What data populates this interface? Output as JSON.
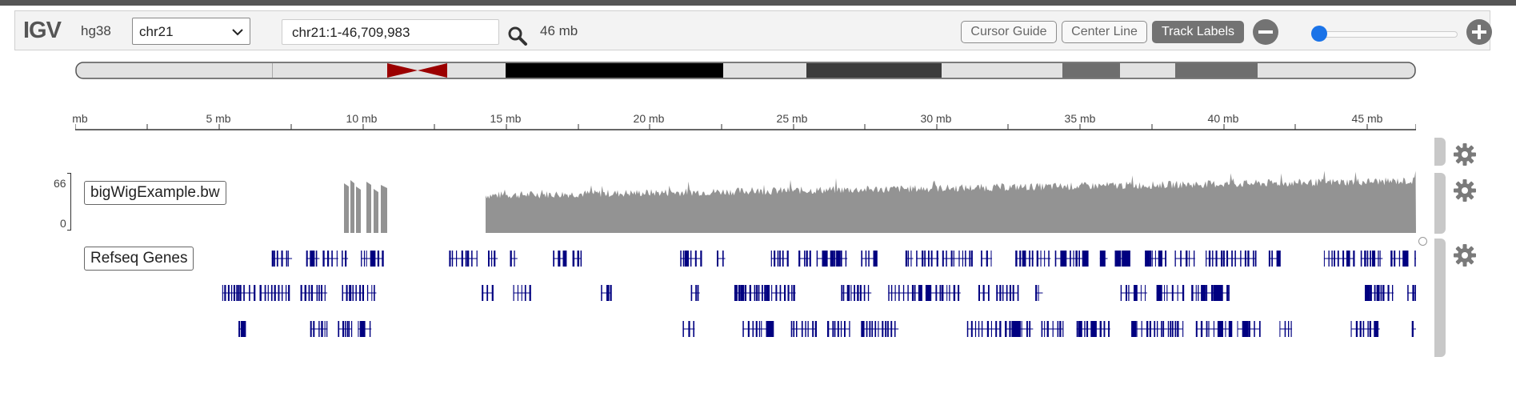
{
  "navbar": {
    "logo": "IGV",
    "genome": "hg38",
    "chromosome_select": "chr21",
    "locus": "chr21:1-46,709,983",
    "window_size": "46 mb",
    "buttons": {
      "cursor_guide": "Cursor Guide",
      "center_line": "Center Line",
      "track_labels": "Track Labels"
    },
    "zoom_fraction": 0.03
  },
  "ruler": {
    "labels": [
      "mb",
      "5 mb",
      "10 mb",
      "15 mb",
      "20 mb",
      "25 mb",
      "30 mb",
      "35 mb",
      "40 mb",
      "45 mb"
    ]
  },
  "tracks": {
    "wig": {
      "label": "bigWigExample.bw",
      "scale_max": "66",
      "scale_min": "0",
      "color": "#939393"
    },
    "refseq": {
      "label": "Refseq Genes",
      "color": "#000080"
    }
  },
  "colors": {
    "centromere": "#9b0000",
    "track_labels_active": "#737373",
    "slider": "#1a73e8"
  }
}
